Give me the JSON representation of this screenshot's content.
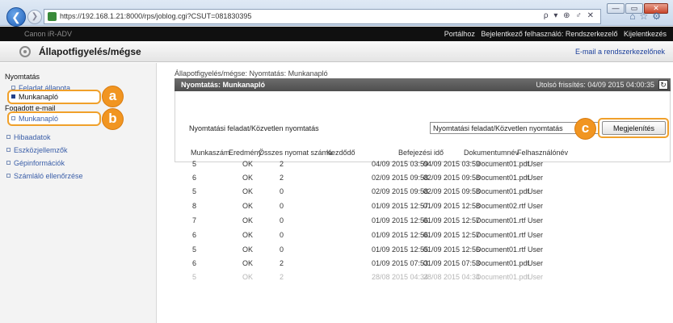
{
  "browser": {
    "url": "https://192.168.1.21:8000/rps/joblog.cgi?CSUT=081830395",
    "search_tools": "ρ ▾ ⊕ ♂ ✕",
    "window_buttons": [
      "—",
      "▭",
      "✕"
    ],
    "toolbar_icons": [
      "home-icon",
      "star-icon",
      "gear-icon"
    ],
    "colors": {
      "back_button": "#1e5fb8"
    }
  },
  "topbar": {
    "device_name": "Canon iR-ADV",
    "links": [
      "Portálhoz",
      "Bejelentkező felhasználó: Rendszerkezelő",
      "Kijelentkezés"
    ]
  },
  "header": {
    "title": "Állapotfigyelés/mégse",
    "mail_link": "E-mail a rendszerkezelőnek"
  },
  "sidebar": {
    "section_print": "Nyomtatás",
    "item_job_status": "Feladat állapota",
    "item_job_log": "Munkanapló",
    "section_email": "Fogadott e-mail",
    "item_email_log": "Munkanapló",
    "items": [
      "Hibaadatok",
      "Eszközjellemzők",
      "Gépinformációk",
      "Számláló ellenőrzése"
    ]
  },
  "callouts": {
    "a": "a",
    "b": "b",
    "c": "c",
    "color": "#f19521"
  },
  "main": {
    "breadcrumb": "Állapotfigyelés/mégse: Nyomtatás: Munkanapló",
    "panel_title": "Nyomtatás: Munkanapló",
    "last_update": "Utolsó frissítés: 04/09 2015 04:00:35",
    "filter_label": "Nyomtatási feladat/Közvetlen nyomtatás",
    "filter_value": "Nyomtatási feladat/Közvetlen nyomtatás",
    "display_button": "Megjelenítés",
    "columns": [
      "Munkaszám",
      "Eredmény",
      "Összes nyomat száma",
      "Kezdődő",
      "Befejezési idő",
      "Dokumentumnév",
      "Felhasználónév"
    ],
    "rows": [
      [
        "5",
        "OK",
        "2",
        "04/09 2015 03:59",
        "04/09 2015 03:59",
        "Document01.pdf",
        "User"
      ],
      [
        "6",
        "OK",
        "2",
        "02/09 2015 09:58",
        "02/09 2015 09:58",
        "Document01.pdf",
        "User"
      ],
      [
        "5",
        "OK",
        "0",
        "02/09 2015 09:58",
        "02/09 2015 09:58",
        "Document01.pdf",
        "User"
      ],
      [
        "8",
        "OK",
        "0",
        "01/09 2015 12:57",
        "01/09 2015 12:58",
        "Document02.rtf",
        "User"
      ],
      [
        "7",
        "OK",
        "0",
        "01/09 2015 12:56",
        "01/09 2015 12:57",
        "Document01.rtf",
        "User"
      ],
      [
        "6",
        "OK",
        "0",
        "01/09 2015 12:56",
        "01/09 2015 12:57",
        "Document01.rtf",
        "User"
      ],
      [
        "5",
        "OK",
        "0",
        "01/09 2015 12:55",
        "01/09 2015 12:56",
        "Document01.rtf",
        "User"
      ],
      [
        "6",
        "OK",
        "2",
        "01/09 2015 07:53",
        "01/09 2015 07:53",
        "Document01.pdf",
        "User"
      ],
      [
        "5",
        "OK",
        "2",
        "28/08 2015 04:34",
        "28/08 2015 04:34",
        "Document01.pdf",
        "User"
      ]
    ]
  }
}
